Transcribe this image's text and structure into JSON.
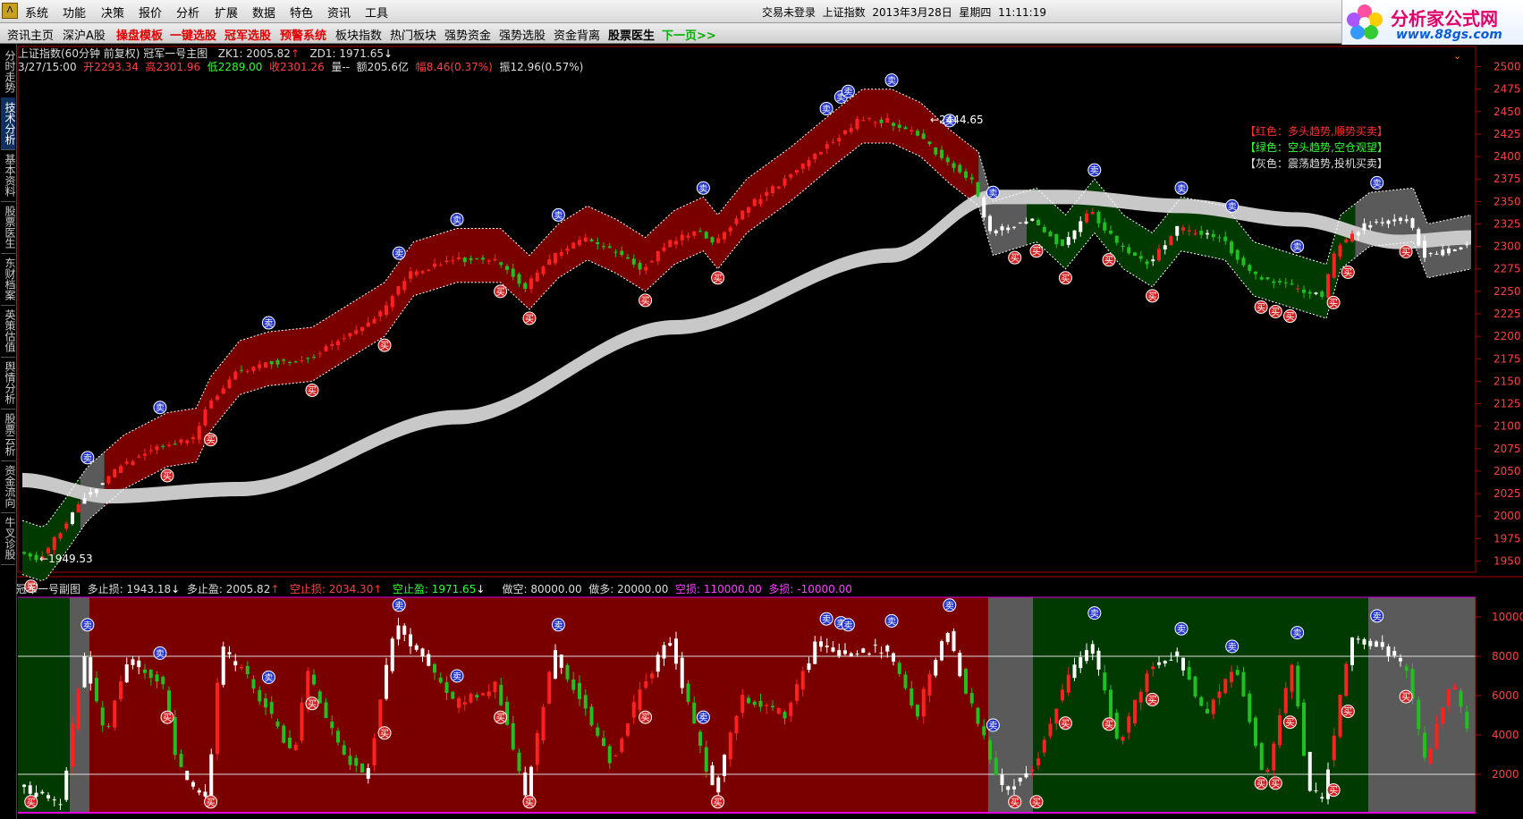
{
  "menubar": {
    "logo": "Λ",
    "items": [
      "系统",
      "功能",
      "决策",
      "报价",
      "分析",
      "扩展",
      "数据",
      "特色",
      "资讯",
      "工具"
    ],
    "login_status": "交易未登录",
    "index_name": "上证指数",
    "date": "2013年3月28日",
    "weekday": "星期四",
    "time": "11:11:19"
  },
  "brand": {
    "title": "分析家公式网",
    "url": "www.88gs.com"
  },
  "toolbar": {
    "items": [
      {
        "label": "资讯主页",
        "style": "normal"
      },
      {
        "label": "深沪A股",
        "style": "normal"
      },
      {
        "label": "操盘模板",
        "style": "red"
      },
      {
        "label": "一键选股",
        "style": "red"
      },
      {
        "label": "冠军选股",
        "style": "red"
      },
      {
        "label": "预警系统",
        "style": "red"
      },
      {
        "label": "板块指数",
        "style": "normal"
      },
      {
        "label": "热门板块",
        "style": "normal"
      },
      {
        "label": "强势资金",
        "style": "normal"
      },
      {
        "label": "强势选股",
        "style": "normal"
      },
      {
        "label": "资金背离",
        "style": "normal"
      },
      {
        "label": "股票医生",
        "style": "bold"
      },
      {
        "label": "下一页>>",
        "style": "green"
      }
    ]
  },
  "sidenav": {
    "tabs": [
      "分时走势",
      "技术分析",
      "基本资料",
      "股票医生",
      "东财档案",
      "英策估值",
      "舆情分析",
      "股票云析",
      "资金流向",
      "牛叉诊股"
    ],
    "active_index": 1
  },
  "main_panel": {
    "title": "上证指数(60分钟 前复权) 冠军一号主图",
    "zk1": "ZK1: 2005.82",
    "zd1": "ZD1: 1971.65",
    "bar_time": "3/27/15:00",
    "open_label": "开",
    "open": "2293.34",
    "high_label": "高",
    "high": "2301.96",
    "low_label": "低",
    "low": "2289.00",
    "close_label": "收",
    "close": "2301.26",
    "volume": "量--",
    "amount": "额205.6亿",
    "change": "幅8.46(0.37%)",
    "amplitude": "振12.96(0.57%)",
    "max_label": "2444.65",
    "min_label": "1949.53",
    "legend": [
      {
        "text": "【红色：多头趋势,顺势买卖】",
        "color": "#ff3030"
      },
      {
        "text": "【绿色：空头趋势,空仓观望】",
        "color": "#30ff30"
      },
      {
        "text": "【灰色：震荡趋势,投机买卖】",
        "color": "#dddddd"
      }
    ],
    "y_ticks": [
      "2500",
      "2475",
      "2450",
      "2425",
      "2400",
      "2375",
      "2350",
      "2325",
      "2300",
      "2275",
      "2250",
      "2225",
      "2200",
      "2175",
      "2150",
      "2125",
      "2100",
      "2075",
      "2050",
      "2025",
      "2000",
      "1975",
      "1950"
    ]
  },
  "sub_panel": {
    "title": "冠军一号副图",
    "stop_long": "多止损: 1943.18",
    "profit_long": "多止盈: 2005.82",
    "stop_short": "空止损: 2034.30",
    "profit_short": "空止盈: 1971.65",
    "do_short": "做空: 80000.00",
    "do_long": "做多: 20000.00",
    "short_loss": "空损: 110000.00",
    "long_loss": "多损: -10000.00",
    "y_ticks": [
      "10000",
      "8000",
      "6000",
      "4000",
      "2000"
    ]
  },
  "signals": {
    "buy": "买",
    "sell": "卖"
  },
  "colors": {
    "bull_band": "#7a0000",
    "bear_band": "#003a00",
    "neutral_band": "#5a5a5a",
    "ma_band": "#c8c8c8",
    "up_candle": "#ff2020",
    "down_candle": "#20c020",
    "axis": "#aa0000",
    "tick_text": "#ff4040"
  }
}
